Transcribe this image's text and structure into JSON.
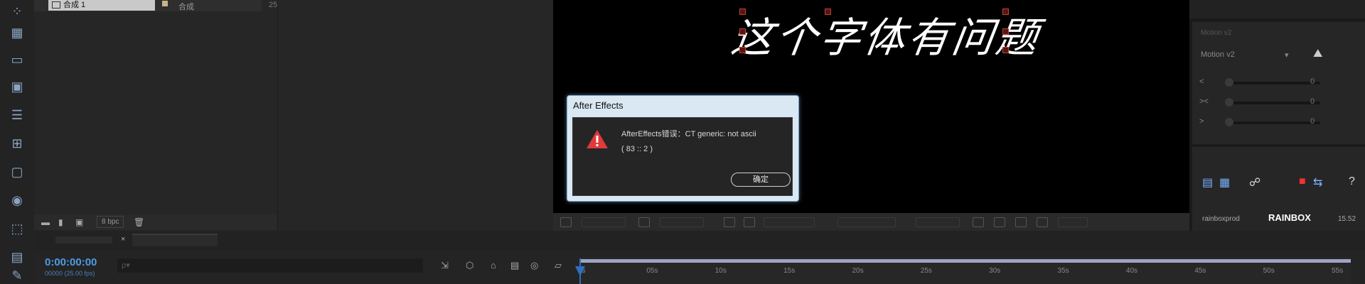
{
  "project": {
    "selected_item": "合成 1",
    "item_type": "合成",
    "item_count": "25",
    "bit_depth": "8 bpc"
  },
  "viewer": {
    "canvas_text": "这个字体有问题"
  },
  "dialog": {
    "title": "After Effects",
    "message": "AfterEffects错误：CT generic: not ascii",
    "code": "( 83 :: 2 )",
    "ok_label": "确定"
  },
  "timeline": {
    "timecode": "0:00:00:00",
    "timecode_sub": "00000 (25.00 fps)",
    "ruler_ticks": [
      "0s",
      "05s",
      "10s",
      "15s",
      "20s",
      "25s",
      "30s",
      "35s",
      "40s",
      "45s",
      "50s",
      "55s"
    ]
  },
  "motion_panel": {
    "title": "Motion v2",
    "preset": "Motion v2",
    "slider_values": [
      "0",
      "0",
      "0"
    ]
  },
  "watermark": {
    "brand": "RAINBOX",
    "caption": "rainboxprod",
    "version": "15.52"
  },
  "colors": {
    "accent_blue": "#4c9be8",
    "dialog_bg": "#d9e8f3",
    "warning_red": "#e03a3a",
    "workarea": "#9fa4c6"
  }
}
